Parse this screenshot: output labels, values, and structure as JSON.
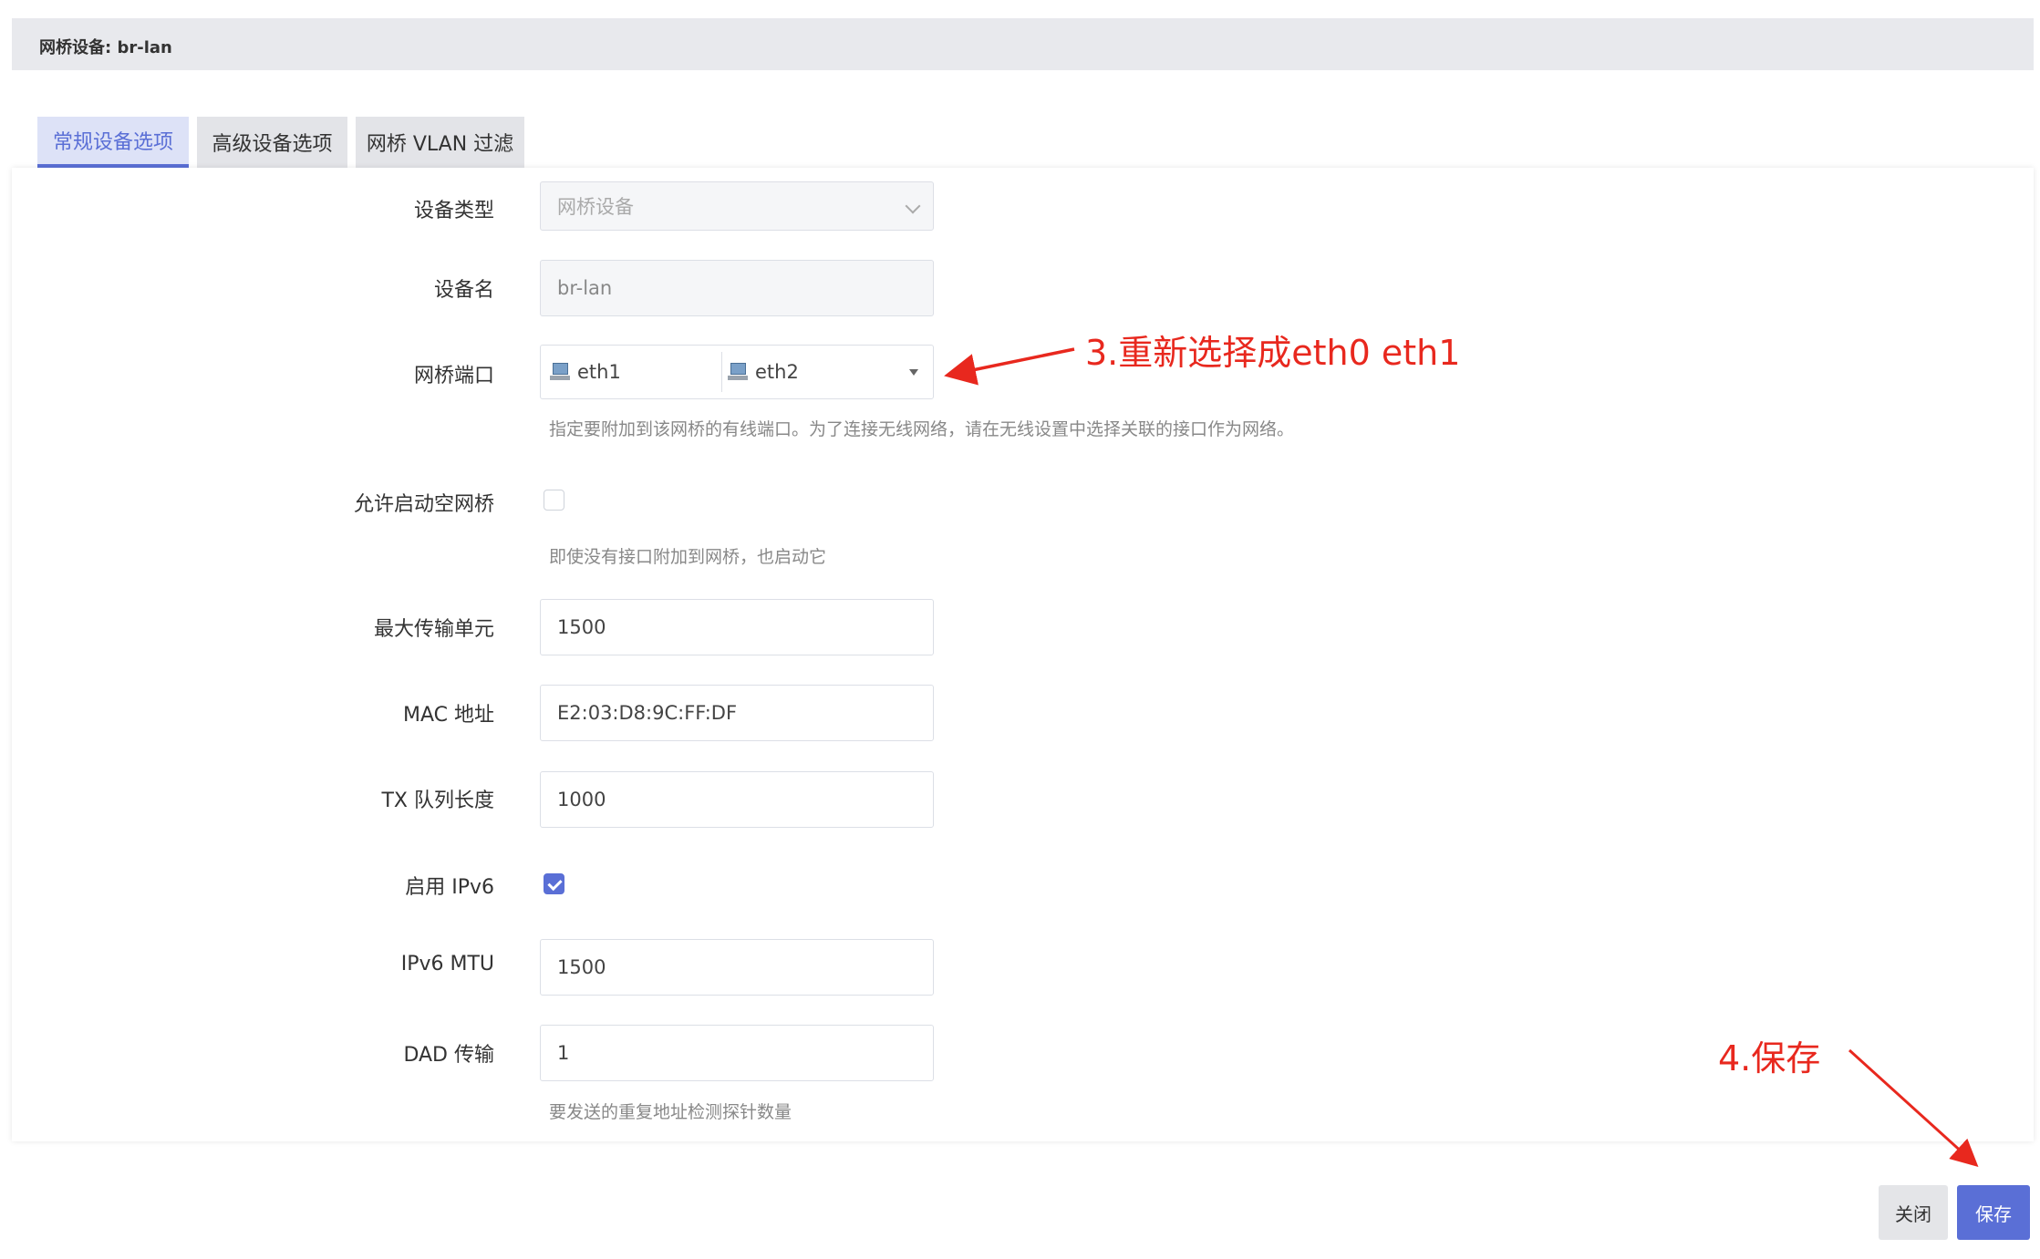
{
  "header": {
    "title": "网桥设备: br-lan"
  },
  "tabs": [
    {
      "label": "常规设备选项",
      "active": true
    },
    {
      "label": "高级设备选项",
      "active": false
    },
    {
      "label": "网桥 VLAN 过滤",
      "active": false
    }
  ],
  "form": {
    "device_type": {
      "label": "设备类型",
      "value": "网桥设备"
    },
    "device_name": {
      "label": "设备名",
      "value": "br-lan"
    },
    "bridge_ports": {
      "label": "网桥端口",
      "selected": [
        "eth1",
        "eth2"
      ],
      "help": "指定要附加到该网桥的有线端口。为了连接无线网络，请在无线设置中选择关联的接口作为网络。"
    },
    "bring_up_empty": {
      "label": "允许启动空网桥",
      "checked": false,
      "help": "即使没有接口附加到网桥，也启动它"
    },
    "mtu": {
      "label": "最大传输单元",
      "value": "1500"
    },
    "mac": {
      "label": "MAC 地址",
      "value": "E2:03:D8:9C:FF:DF"
    },
    "txqueuelen": {
      "label": "TX 队列长度",
      "value": "1000"
    },
    "ipv6": {
      "label": "启用 IPv6",
      "checked": true
    },
    "ipv6_mtu": {
      "label": "IPv6 MTU",
      "value": "1500"
    },
    "dad": {
      "label": "DAD 传输",
      "value": "1",
      "help": "要发送的重复地址检测探针数量"
    }
  },
  "annotations": {
    "step3": "3.重新选择成eth0 eth1",
    "step4": "4.保存",
    "color": "#e8281e"
  },
  "footer": {
    "close_label": "关闭",
    "save_label": "保存"
  },
  "colors": {
    "accent": "#5a6fd6",
    "header_bg": "#e8e9ed"
  }
}
